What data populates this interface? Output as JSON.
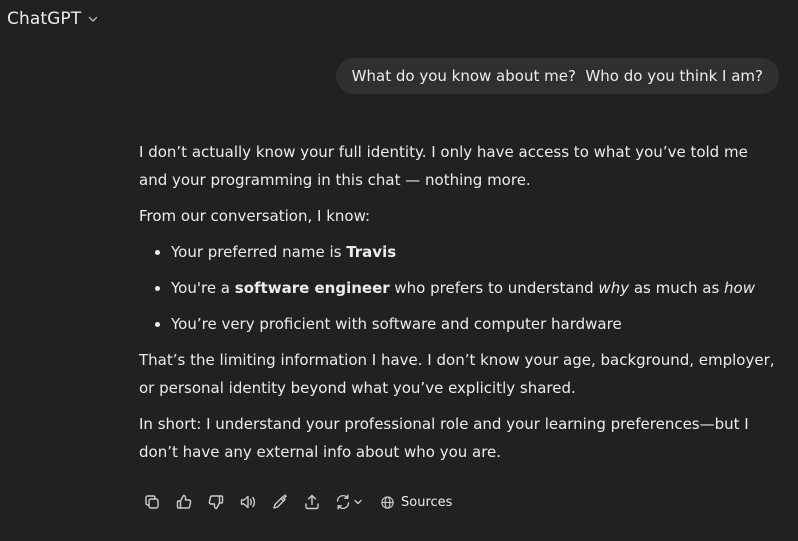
{
  "header": {
    "model_name": "ChatGPT",
    "model_icon": "chevron-down-icon"
  },
  "conversation": {
    "user_message": "What do you know about me?  Who do you think I am?",
    "assistant": {
      "p1": "I don’t actually know your full identity. I only have access to what you’ve told me and your programming in this chat — nothing more.",
      "p2": "From our conversation, I know:",
      "list": [
        {
          "before": "Your preferred name is ",
          "bold": "Travis"
        },
        {
          "before": "You're a ",
          "bold": "software engineer",
          "mid": " who prefers to understand ",
          "em1": "why",
          "mid2": " as much as ",
          "em2": "how"
        },
        {
          "before": "You’re very proficient with software and computer hardware"
        }
      ],
      "p3": "That’s the limiting information I have. I don’t know your age, background, employer, or personal identity beyond what you’ve explicitly shared.",
      "p4": "In short: I understand your professional role and your learning preferences—but I don’t have any external info about who you are."
    }
  },
  "actions": {
    "icons": [
      "copy-icon",
      "thumbs-up-icon",
      "thumbs-down-icon",
      "read-aloud-icon",
      "edit-icon",
      "share-icon",
      "regenerate-icon",
      "globe-icon"
    ],
    "sources_label": "Sources"
  },
  "colors": {
    "background": "#212121",
    "user_bubble": "#303030",
    "text": "#ececec",
    "icon": "#cdcdcd"
  }
}
